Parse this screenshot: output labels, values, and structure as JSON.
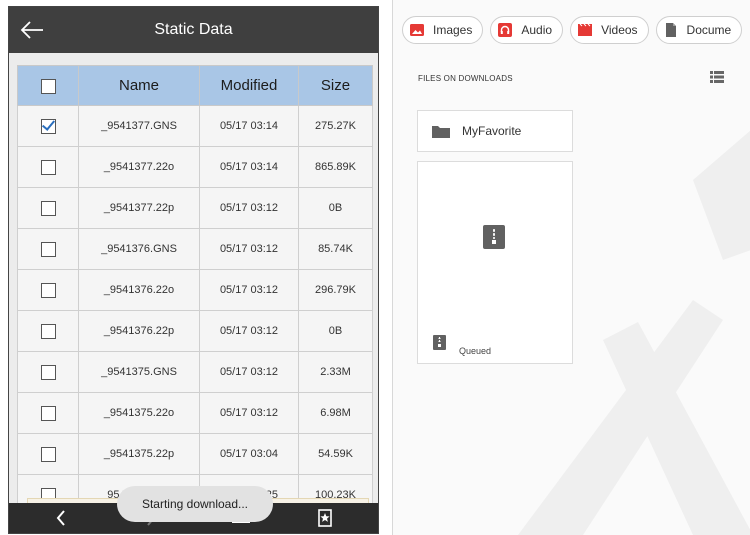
{
  "left_app": {
    "title": "Static Data",
    "table": {
      "headers": {
        "name": "Name",
        "modified": "Modified",
        "size": "Size"
      },
      "rows": [
        {
          "checked": true,
          "name": "_9541377.GNS",
          "modified": "05/17 03:14",
          "size": "275.27K"
        },
        {
          "checked": false,
          "name": "_9541377.22o",
          "modified": "05/17 03:14",
          "size": "865.89K"
        },
        {
          "checked": false,
          "name": "_9541377.22p",
          "modified": "05/17 03:12",
          "size": "0B"
        },
        {
          "checked": false,
          "name": "_9541376.GNS",
          "modified": "05/17 03:12",
          "size": "85.74K"
        },
        {
          "checked": false,
          "name": "_9541376.22o",
          "modified": "05/17 03:12",
          "size": "296.79K"
        },
        {
          "checked": false,
          "name": "_9541376.22p",
          "modified": "05/17 03:12",
          "size": "0B"
        },
        {
          "checked": false,
          "name": "_9541375.GNS",
          "modified": "05/17 03:12",
          "size": "2.33M"
        },
        {
          "checked": false,
          "name": "_9541375.22o",
          "modified": "05/17 03:12",
          "size": "6.98M"
        },
        {
          "checked": false,
          "name": "_9541375.22p",
          "modified": "05/17 03:04",
          "size": "54.59K"
        },
        {
          "checked": false,
          "name": "_9541374.GNS",
          "modified": "05/17 02:25",
          "size": "100.23K"
        }
      ]
    },
    "toast": "Starting download...",
    "nav_icons": [
      "back-chevron-icon",
      "forward-chevron-icon",
      "transfer-icon",
      "bookmark-icon"
    ]
  },
  "right_app": {
    "chips": [
      {
        "label": "Images",
        "icon": "image-icon",
        "color": "#e53935"
      },
      {
        "label": "Audio",
        "icon": "headphones-icon",
        "color": "#e53935"
      },
      {
        "label": "Videos",
        "icon": "clapperboard-icon",
        "color": "#e53935"
      },
      {
        "label": "Docume",
        "icon": "document-icon",
        "color": "#616161"
      }
    ],
    "section_label": "FILES ON DOWNLOADS",
    "folder": {
      "name": "MyFavorite",
      "icon": "folder-icon"
    },
    "file": {
      "status": "Queued",
      "icon": "zip-archive-icon"
    }
  },
  "colors": {
    "header_bg": "#3f3f3f",
    "table_header_bg": "#a9c6e6",
    "check_color": "#2a6ebd",
    "accent_red": "#e53935"
  }
}
